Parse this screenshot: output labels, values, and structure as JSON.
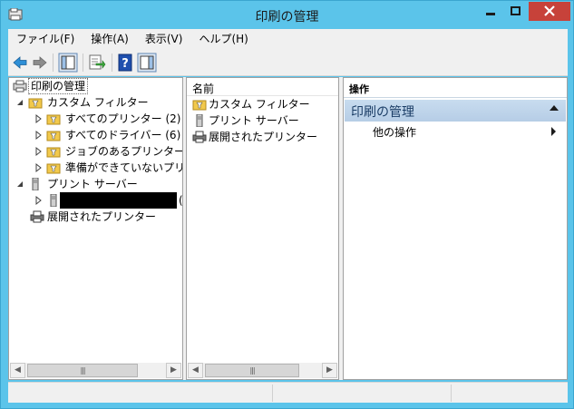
{
  "window": {
    "title": "印刷の管理"
  },
  "menu": {
    "items": [
      {
        "label": "ファイル(F)",
        "name": "menu-file"
      },
      {
        "label": "操作(A)",
        "name": "menu-action"
      },
      {
        "label": "表示(V)",
        "name": "menu-view"
      },
      {
        "label": "ヘルプ(H)",
        "name": "menu-help"
      }
    ]
  },
  "toolbar": {
    "icons": [
      "back-arrow-icon",
      "forward-arrow-icon",
      "show-console-tree-icon",
      "export-list-icon",
      "help-icon",
      "show-action-pane-icon"
    ]
  },
  "tree": {
    "root": "印刷の管理",
    "custom_filters": "カスタム フィルター",
    "all_printers": "すべてのプリンター (2)",
    "all_drivers": "すべてのドライバー (6)",
    "printers_with_jobs": "ジョブのあるプリンター",
    "printers_not_ready": "準備ができていないプリンタ",
    "print_servers": "プリント サーバー",
    "server_suffix": "(",
    "deployed_printers": "展開されたプリンター"
  },
  "list": {
    "header_name": "名前",
    "rows": [
      "カスタム フィルター",
      "プリント サーバー",
      "展開されたプリンター"
    ]
  },
  "actions": {
    "header": "操作",
    "section_title": "印刷の管理",
    "more_actions": "他の操作"
  },
  "colors": {
    "titlebar": "#5bc4ea",
    "close_button": "#c7423a",
    "action_section": "#c8dcef"
  }
}
